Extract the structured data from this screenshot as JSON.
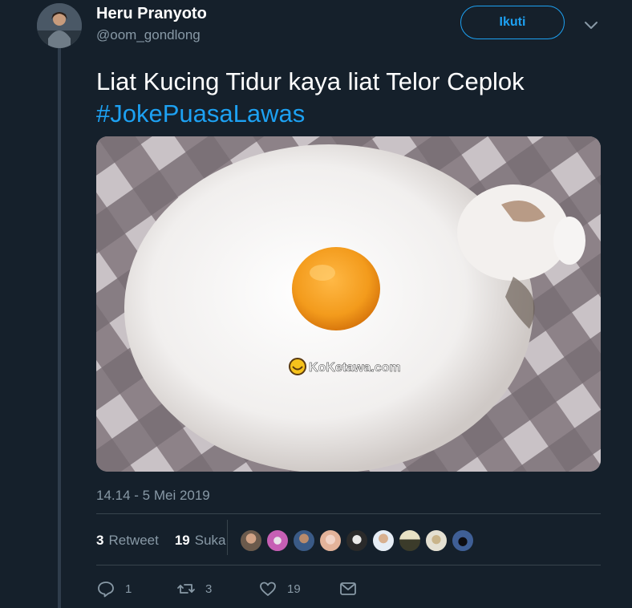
{
  "user": {
    "display_name": "Heru Pranyoto",
    "handle": "@oom_gondlong"
  },
  "header": {
    "follow_label": "Ikuti"
  },
  "tweet": {
    "text": "Liat Kucing Tidur kaya liat Telor Ceplok",
    "hashtag": "#JokePuasaLawas",
    "image_watermark": "KoKetawa.com",
    "timestamp": "14.14 - 5 Mei 2019"
  },
  "stats": {
    "retweets_count": "3",
    "retweets_label": "Retweet",
    "likes_count": "19",
    "likes_label": "Suka"
  },
  "actions": {
    "reply_count": "1",
    "retweet_count": "3",
    "like_count": "19"
  },
  "colors": {
    "background": "#15202b",
    "accent": "#1da1f2",
    "muted": "#8899a6"
  }
}
